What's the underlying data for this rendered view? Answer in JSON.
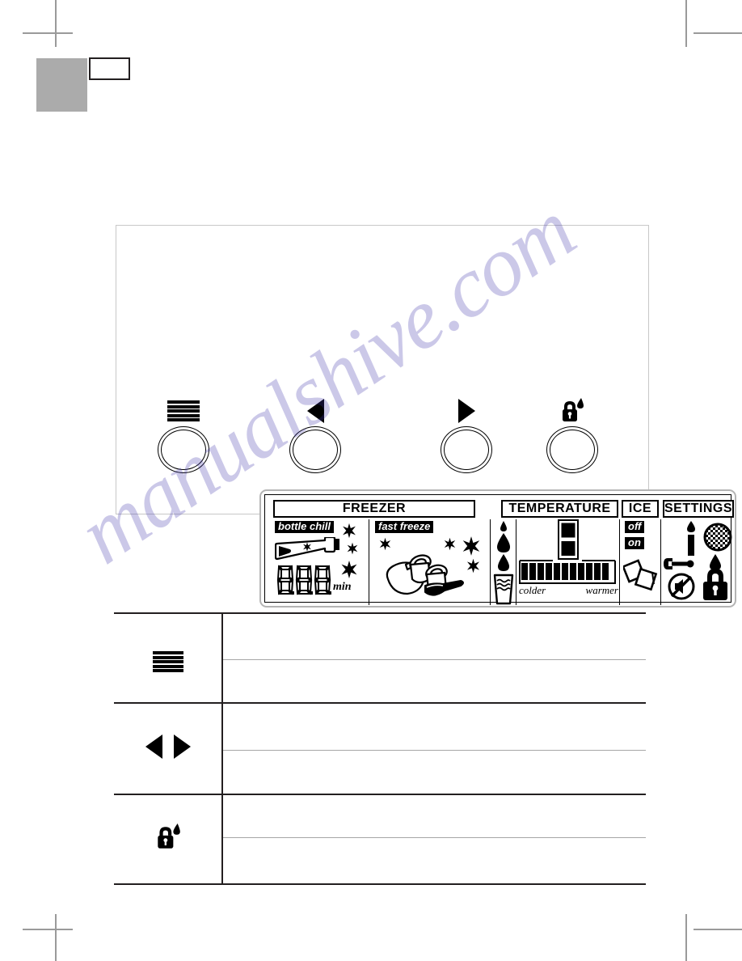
{
  "page": {
    "watermark": "manualshive.com",
    "gray_marker": "",
    "number_box": ""
  },
  "control_panel": {
    "display": {
      "headers": {
        "freezer": "FREEZER",
        "temperature": "TEMPERATURE",
        "ice": "ICE",
        "settings": "SETTINGS"
      },
      "freezer_section": {
        "bottle_chill": {
          "label": "bottle chill",
          "timer_value": "888",
          "timer_unit": "min",
          "icon": "bottle-icon",
          "snowflakes": 3
        },
        "fast_freeze": {
          "label": "fast freeze",
          "icon": "frozen-food-icon",
          "snowflakes": 4
        }
      },
      "water_section": {
        "icons": [
          "water-drop-icon",
          "water-drop-icon",
          "water-drop-icon",
          "water-glass-icon"
        ]
      },
      "temperature_section": {
        "cabinet_icon": "fridge-freezer-icon",
        "scale_segments": 11,
        "scale_filled": 11,
        "label_low": "colder",
        "label_high": "warmer"
      },
      "ice_section": {
        "off_label": "off",
        "on_label": "on",
        "icon": "ice-cubes-icon"
      },
      "settings_section": {
        "icons": [
          "candle-sabbath-icon",
          "checkered-ball-icon",
          "wrench-icon",
          "water-drop-icon",
          "speaker-mute-icon",
          "key-lock-icon"
        ]
      }
    },
    "buttons": [
      {
        "name": "menu-button",
        "glyph": "hamburger-icon"
      },
      {
        "name": "left-button",
        "glyph": "triangle-left-icon"
      },
      {
        "name": "right-button",
        "glyph": "triangle-right-icon"
      },
      {
        "name": "lock-button",
        "glyph": "lock-drop-icon"
      }
    ]
  },
  "legend_table": {
    "rows": [
      {
        "icon": "hamburger-icon",
        "lines": [
          "",
          ""
        ]
      },
      {
        "icon": "arrows-icon",
        "lines": [
          "",
          ""
        ]
      },
      {
        "icon": "lock-drop-icon",
        "lines": [
          "",
          ""
        ]
      }
    ]
  },
  "colors": {
    "ink": "#000000",
    "gray_marker": "#ababab",
    "rule": "#231f20",
    "subrule": "#a6a6a6",
    "watermark": "rgba(64,52,170,0.27)"
  }
}
